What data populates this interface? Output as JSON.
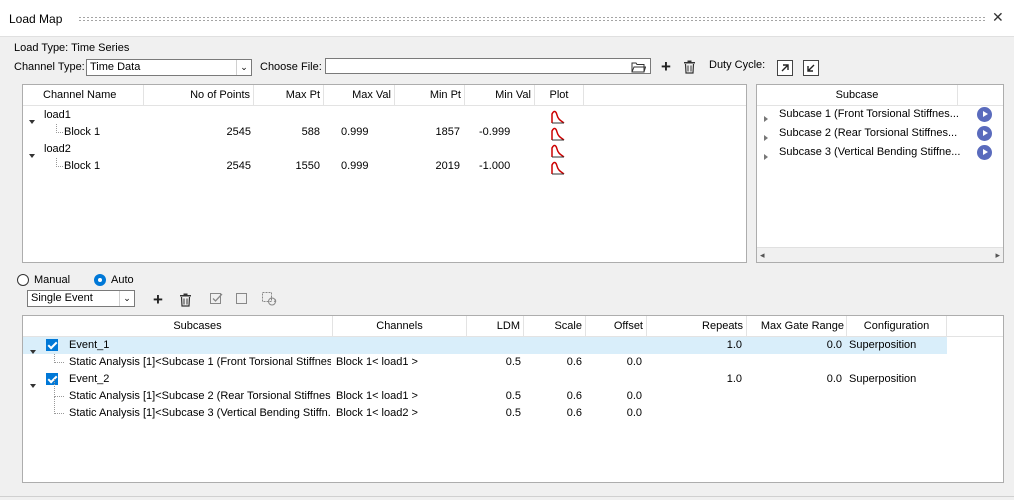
{
  "window": {
    "title": "Load Map"
  },
  "load_type": {
    "label": "Load Type:",
    "value": "Time Series"
  },
  "channel_type": {
    "label": "Channel Type:",
    "value": "Time Data"
  },
  "choose_file": {
    "label": "Choose File:",
    "value": ""
  },
  "duty_cycle": {
    "label": "Duty Cycle:"
  },
  "channel_table": {
    "headers": [
      "Channel Name",
      "No of Points",
      "Max Pt",
      "Max Val",
      "Min Pt",
      "Min Val",
      "Plot"
    ],
    "rows": [
      {
        "name": "load1",
        "level": 0
      },
      {
        "name": "Block 1",
        "level": 1,
        "points": "2545",
        "max_pt": "588",
        "max_val": "0.999",
        "min_pt": "1857",
        "min_val": "-0.999"
      },
      {
        "name": "load2",
        "level": 0
      },
      {
        "name": "Block 1",
        "level": 1,
        "points": "2545",
        "max_pt": "1550",
        "max_val": "0.999",
        "min_pt": "2019",
        "min_val": "-1.000"
      }
    ]
  },
  "subcase_panel": {
    "header": "Subcase",
    "items": [
      "Subcase 1 (Front Torsional Stiffnes...",
      "Subcase 2 (Rear Torsional Stiffnes...",
      "Subcase 3 (Vertical Bending Stiffne..."
    ]
  },
  "mode": {
    "manual": "Manual",
    "auto": "Auto",
    "selected": "Auto"
  },
  "event_type": {
    "value": "Single Event"
  },
  "event_table": {
    "headers": [
      "Subcases",
      "Channels",
      "LDM",
      "Scale",
      "Offset",
      "Repeats",
      "Max Gate Range",
      "Configuration"
    ],
    "rows": [
      {
        "kind": "event",
        "name": "Event_1",
        "repeats": "1.0",
        "max_gate": "0.0",
        "config": "Superposition"
      },
      {
        "kind": "item",
        "subcase": "Static Analysis [1]<Subcase 1 (Front Torsional Stiffnes...",
        "channel": "Block 1< load1 >",
        "ldm": "0.5",
        "scale": "0.6",
        "offset": "0.0"
      },
      {
        "kind": "event",
        "name": "Event_2",
        "repeats": "1.0",
        "max_gate": "0.0",
        "config": "Superposition"
      },
      {
        "kind": "item",
        "subcase": "Static Analysis [1]<Subcase 2 (Rear Torsional Stiffnes...",
        "channel": "Block 1< load1 >",
        "ldm": "0.5",
        "scale": "0.6",
        "offset": "0.0"
      },
      {
        "kind": "item",
        "subcase": "Static Analysis [1]<Subcase 3 (Vertical Bending Stiffn...",
        "channel": "Block 1< load2 >",
        "ldm": "0.5",
        "scale": "0.6",
        "offset": "0.0"
      }
    ]
  },
  "icons": {
    "plot": "plot-icon",
    "add": "plus-icon",
    "delete": "trash-icon",
    "folder": "folder-icon",
    "play": "play-icon",
    "close": "close-icon"
  },
  "colors": {
    "accent": "#0078d7",
    "selected_row": "#d9eefa",
    "plot_red": "#cc0000",
    "play": "#5a6bbd"
  }
}
